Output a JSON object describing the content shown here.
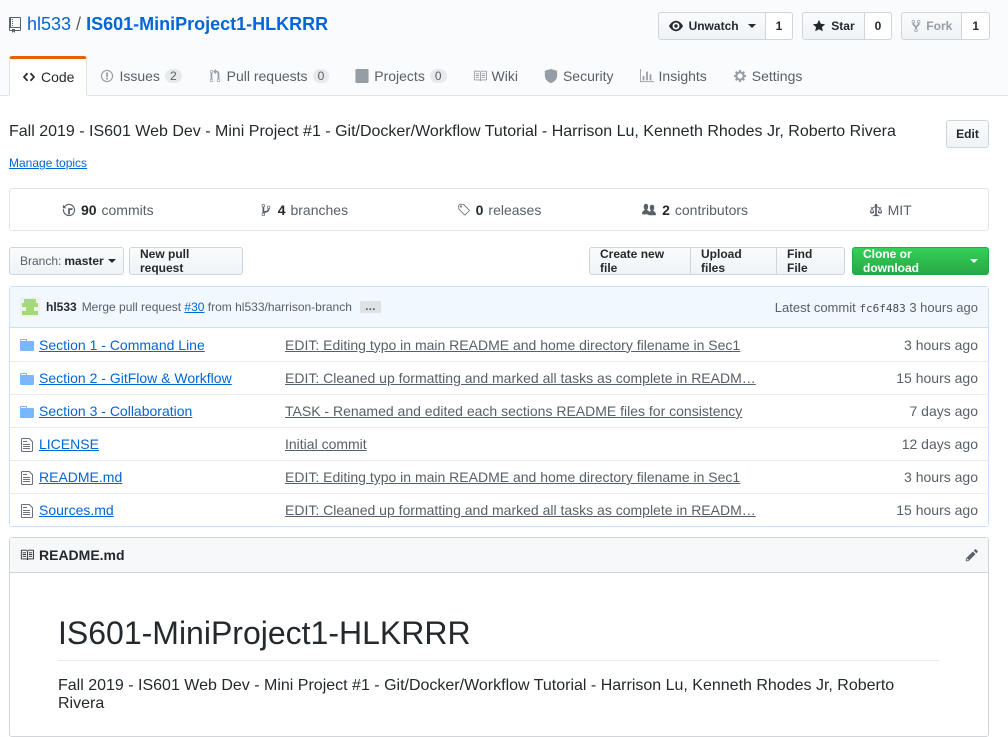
{
  "repo": {
    "owner": "hl533",
    "separator": "/",
    "name": "IS601-MiniProject1-HLKRRR"
  },
  "actions": {
    "watch_label": "Unwatch",
    "watch_count": "1",
    "star_label": "Star",
    "star_count": "0",
    "fork_label": "Fork",
    "fork_count": "1"
  },
  "tabs": [
    {
      "label": "Code",
      "icon": "code-icon",
      "counter": ""
    },
    {
      "label": "Issues",
      "icon": "issue-icon",
      "counter": "2"
    },
    {
      "label": "Pull requests",
      "icon": "pull-request-icon",
      "counter": "0"
    },
    {
      "label": "Projects",
      "icon": "project-icon",
      "counter": "0"
    },
    {
      "label": "Wiki",
      "icon": "book-icon",
      "counter": ""
    },
    {
      "label": "Security",
      "icon": "shield-icon",
      "counter": ""
    },
    {
      "label": "Insights",
      "icon": "graph-icon",
      "counter": ""
    },
    {
      "label": "Settings",
      "icon": "gear-icon",
      "counter": ""
    }
  ],
  "description": "Fall 2019 - IS601 Web Dev - Mini Project #1 - Git/Docker/Workflow Tutorial - Harrison Lu, Kenneth Rhodes Jr, Roberto Rivera",
  "edit_label": "Edit",
  "manage_topics": "Manage topics",
  "summary": {
    "commits_count": "90",
    "commits_label": "commits",
    "branches_count": "4",
    "branches_label": "branches",
    "releases_count": "0",
    "releases_label": "releases",
    "contributors_count": "2",
    "contributors_label": "contributors",
    "license": "MIT"
  },
  "filebar": {
    "branch_prefix": "Branch:",
    "branch_name": "master",
    "new_pr": "New pull request",
    "create_file": "Create new file",
    "upload_files": "Upload files",
    "find_file": "Find File",
    "clone": "Clone or download"
  },
  "commit": {
    "author": "hl533",
    "message_prefix": "Merge pull request",
    "pr_link": "#30",
    "message_suffix": "from hl533/harrison-branch",
    "ellipsis": "…",
    "latest_label": "Latest commit",
    "sha": "fc6f483",
    "age": "3 hours ago"
  },
  "files": [
    {
      "type": "folder",
      "name": "Section 1 - Command Line",
      "message": "EDIT: Editing typo in main README and home directory filename in Sec1",
      "age": "3 hours ago"
    },
    {
      "type": "folder",
      "name": "Section 2 - GitFlow & Workflow",
      "message": "EDIT: Cleaned up formatting and marked all tasks as complete in READM…",
      "age": "15 hours ago"
    },
    {
      "type": "folder",
      "name": "Section 3 - Collaboration",
      "message": "TASK - Renamed and edited each sections README files for consistency",
      "age": "7 days ago"
    },
    {
      "type": "file",
      "name": "LICENSE",
      "message": "Initial commit",
      "age": "12 days ago"
    },
    {
      "type": "file",
      "name": "README.md",
      "message": "EDIT: Editing typo in main README and home directory filename in Sec1",
      "age": "3 hours ago"
    },
    {
      "type": "file",
      "name": "Sources.md",
      "message": "EDIT: Cleaned up formatting and marked all tasks as complete in READM…",
      "age": "15 hours ago"
    }
  ],
  "readme": {
    "header": "README.md",
    "title": "IS601-MiniProject1-HLKRRR",
    "paragraph": "Fall 2019 - IS601 Web Dev - Mini Project #1 - Git/Docker/Workflow Tutorial - Harrison Lu, Kenneth Rhodes Jr, Roberto Rivera"
  },
  "colors": {
    "link": "#0366d6",
    "active_tab": "#e36209",
    "clone_green": "#28a745",
    "folder": "#79b8ff"
  }
}
